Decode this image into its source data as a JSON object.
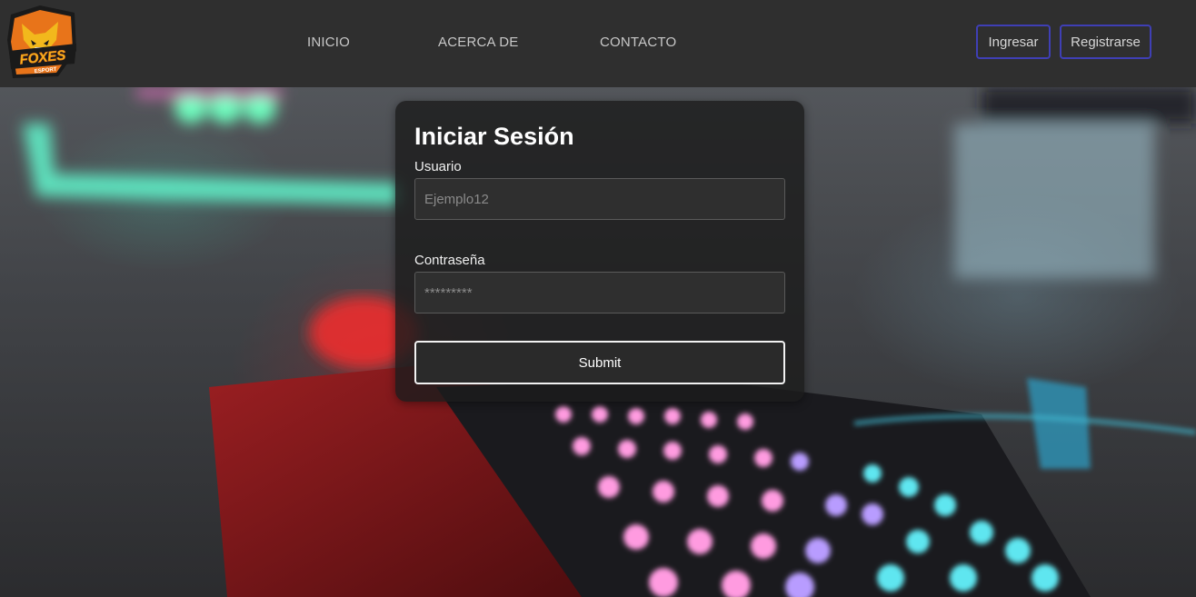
{
  "brand": {
    "logo_text": "FOXES",
    "logo_subtext": "ESPORT",
    "logo_colors": {
      "orange": "#e8741a",
      "yellow": "#f2b81c",
      "dark": "#1a1a1a"
    }
  },
  "nav": {
    "links": [
      {
        "label": "INICIO"
      },
      {
        "label": "ACERCA DE"
      },
      {
        "label": "CONTACTO"
      }
    ],
    "login_label": "Ingresar",
    "register_label": "Registrarse",
    "button_border_color": "#3f3fb5"
  },
  "login": {
    "title": "Iniciar Sesión",
    "username_label": "Usuario",
    "username_placeholder": "Ejemplo12",
    "password_label": "Contraseña",
    "password_placeholder": "*********",
    "submit_label": "Submit"
  },
  "background": {
    "description_icon": "gaming-keyboard-photo"
  }
}
